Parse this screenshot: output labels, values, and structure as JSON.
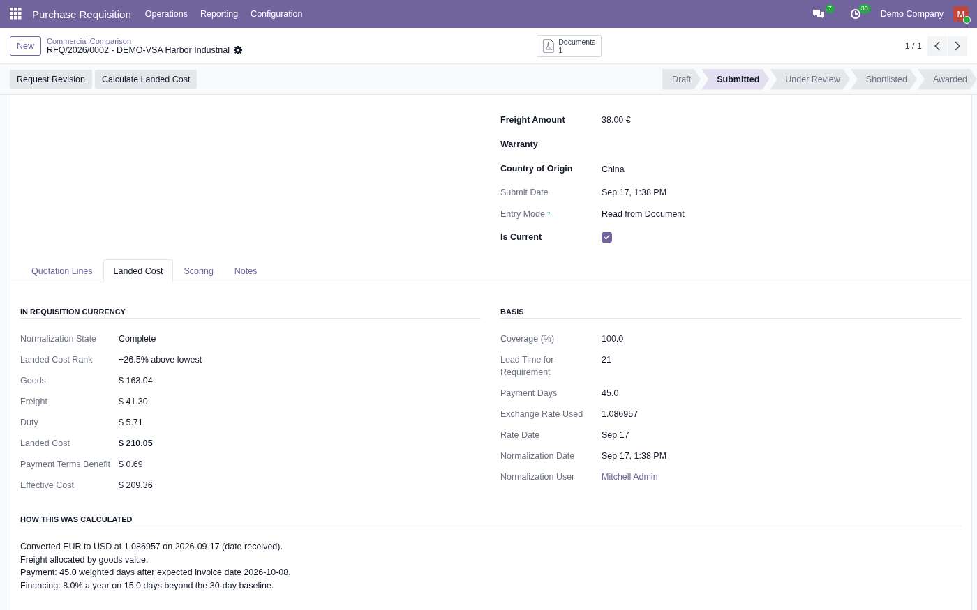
{
  "navbar": {
    "app_name": "Purchase Requisition",
    "menu": [
      "Operations",
      "Reporting",
      "Configuration"
    ],
    "messages_count": "7",
    "activities_count": "30",
    "company": "Demo Company",
    "avatar_letter": "M"
  },
  "control_panel": {
    "new_button": "New",
    "breadcrumb": "Commercial Comparison",
    "record_title": "RFQ/2026/0002 - DEMO-VSA Harbor Industrial",
    "documents": {
      "label": "Documents",
      "count": "1"
    },
    "pager": "1 / 1"
  },
  "actions": [
    "Request Revision",
    "Calculate Landed Cost"
  ],
  "stages": [
    {
      "label": "Draft",
      "selected": false
    },
    {
      "label": "Submitted",
      "selected": true
    },
    {
      "label": "Under Review",
      "selected": false
    },
    {
      "label": "Shortlisted",
      "selected": false
    },
    {
      "label": "Awarded",
      "selected": false
    }
  ],
  "fields": [
    {
      "label": "Freight Amount",
      "bold": true,
      "kind": "text",
      "value": "38.00 €"
    },
    {
      "label": "Warranty",
      "bold": true,
      "kind": "text"
    },
    {
      "label": "Country of Origin",
      "bold": true,
      "kind": "text",
      "value": "China"
    },
    {
      "label": "Submit Date",
      "bold": false,
      "kind": "text",
      "value": "Sep 17, 1:38 PM"
    },
    {
      "label": "Entry Mode",
      "bold": false,
      "kind": "text",
      "help": "?",
      "value": "Read from Document"
    },
    {
      "label": "Is Current",
      "bold": true,
      "kind": "checkbox",
      "checked": true
    }
  ],
  "tabs": [
    {
      "label": "Quotation Lines",
      "selected": false
    },
    {
      "label": "Landed Cost",
      "selected": true
    },
    {
      "label": "Scoring",
      "selected": false
    },
    {
      "label": "Notes",
      "selected": false
    }
  ],
  "sections": [
    {
      "title": "IN REQUISITION CURRENCY",
      "rows": [
        {
          "label": "Normalization State",
          "value": "Complete",
          "kind": "text"
        },
        {
          "label": "Landed Cost Rank",
          "value": "+26.5% above lowest",
          "kind": "text"
        },
        {
          "label": "Goods",
          "value": "$ 163.04",
          "kind": "text"
        },
        {
          "label": "Freight",
          "value": "$ 41.30",
          "kind": "text"
        },
        {
          "label": "Duty",
          "value": "$ 5.71",
          "kind": "text"
        },
        {
          "label": "Landed Cost",
          "value": "$ 210.05",
          "kind": "bold"
        },
        {
          "label": "Payment Terms Benefit",
          "value": "$ 0.69",
          "kind": "text"
        },
        {
          "label": "Effective Cost",
          "value": "$ 209.36",
          "kind": "text"
        }
      ]
    },
    {
      "title": "BASIS",
      "rows": [
        {
          "label": "Coverage (%)",
          "value": "100.0",
          "kind": "text"
        },
        {
          "label": "Lead Time for Requirement",
          "value": "21",
          "kind": "text"
        },
        {
          "label": "Payment Days",
          "value": "45.0",
          "kind": "text"
        },
        {
          "label": "Exchange Rate Used",
          "value": "1.086957",
          "kind": "text"
        },
        {
          "label": "Rate Date",
          "value": "Sep 17",
          "kind": "text"
        },
        {
          "label": "Normalization Date",
          "value": "Sep 17, 1:38 PM",
          "kind": "text"
        },
        {
          "label": "Normalization User",
          "value": "Mitchell Admin",
          "kind": "link"
        }
      ]
    }
  ],
  "calculation": {
    "title": "HOW THIS WAS CALCULATED",
    "lines": [
      "Converted EUR to USD at 1.086957 on 2026-09-17 (date received).",
      "Freight allocated by goods value.",
      "Payment: 45.0 weighted days after expected invoice date 2026-10-08.",
      "Financing: 8.0% a year on 15.0 days beyond the 30-day baseline."
    ]
  }
}
